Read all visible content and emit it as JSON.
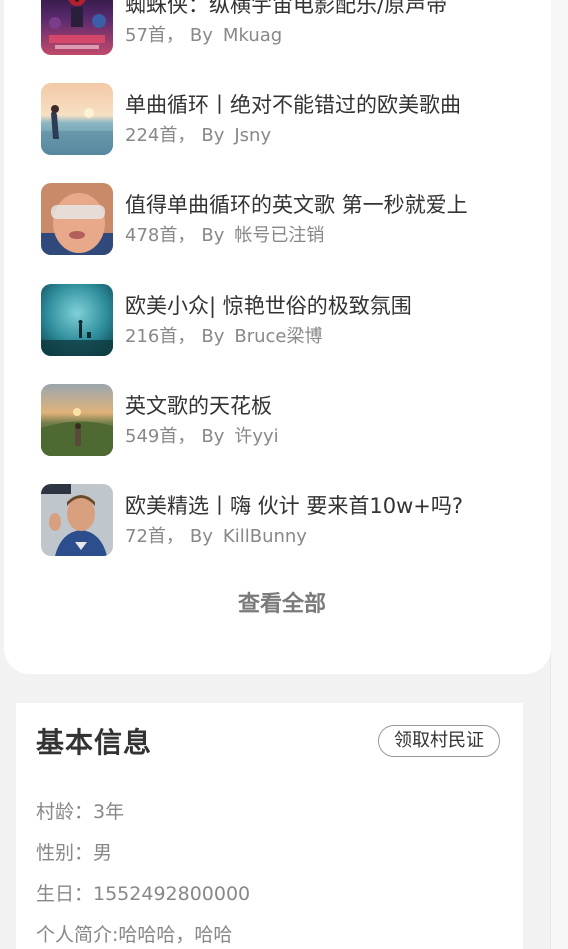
{
  "playlists": [
    {
      "title": "蜘蛛侠：纵横宇宙电影配乐/原声带",
      "count": "57首，",
      "by": "By",
      "author": "Mkuag",
      "cover": "spiderman-cover"
    },
    {
      "title": "单曲循环丨绝对不能错过的欧美歌曲",
      "count": "224首，",
      "by": "By",
      "author": "Jsny",
      "cover": "beach-sunset-cover"
    },
    {
      "title": "值得单曲循环的英文歌 第一秒就爱上",
      "count": "478首，",
      "by": "By",
      "author": "帐号已注销",
      "cover": "face-glasses-cover"
    },
    {
      "title": "欧美小众| 惊艳世俗的极致氛围",
      "count": "216首，",
      "by": "By",
      "author": "Bruce梁博",
      "cover": "misty-blue-cover"
    },
    {
      "title": "英文歌的天花板",
      "count": "549首，",
      "by": "By",
      "author": "许yyi",
      "cover": "hill-sunset-cover"
    },
    {
      "title": "欧美精选丨嗨 伙计 要来首10w+吗?",
      "count": "72首，",
      "by": "By",
      "author": "KillBunny",
      "cover": "man-portrait-cover"
    }
  ],
  "view_all_label": "查看全部",
  "info": {
    "title": "基本信息",
    "claim_button": "领取村民证",
    "age": "村龄：3年",
    "gender": "性别：男",
    "birthday": "生日：1552492800000",
    "bio": "个人简介:哈哈哈，哈哈"
  }
}
